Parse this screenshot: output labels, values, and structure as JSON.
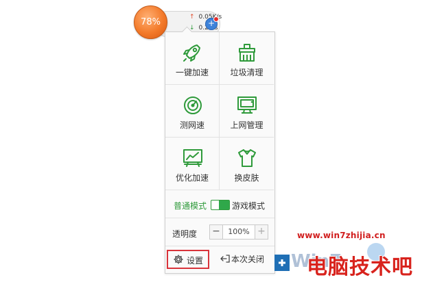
{
  "speed_ball": {
    "percent": "78%",
    "upload": "0.05K/s",
    "download": "0.2K/s",
    "add_icon": "plus-icon",
    "upload_icon": "arrow-up-icon",
    "download_icon": "arrow-down-icon"
  },
  "menu": {
    "tiles": [
      {
        "label": "一键加速",
        "icon": "rocket-icon"
      },
      {
        "label": "垃圾清理",
        "icon": "broom-icon"
      },
      {
        "label": "测网速",
        "icon": "speedometer-icon"
      },
      {
        "label": "上网管理",
        "icon": "monitor-icon"
      },
      {
        "label": "优化加速",
        "icon": "chart-board-icon"
      },
      {
        "label": "换皮肤",
        "icon": "tshirt-icon"
      }
    ],
    "mode": {
      "normal_label": "普通模式",
      "game_label": "游戏模式",
      "active": "游戏模式",
      "accent": "#2fa84a"
    },
    "opacity": {
      "label": "透明度",
      "minus": "−",
      "value": "100%",
      "plus": "+"
    },
    "footer": {
      "settings_label": "设置",
      "settings_icon": "gear-icon",
      "settings_highlight": "#d9333a",
      "close_label": "本次关闭",
      "close_icon": "exit-icon"
    }
  },
  "watermark": {
    "url": "www.win7zhijia.cn",
    "text": "电脑技术吧",
    "logo": "Win7"
  }
}
